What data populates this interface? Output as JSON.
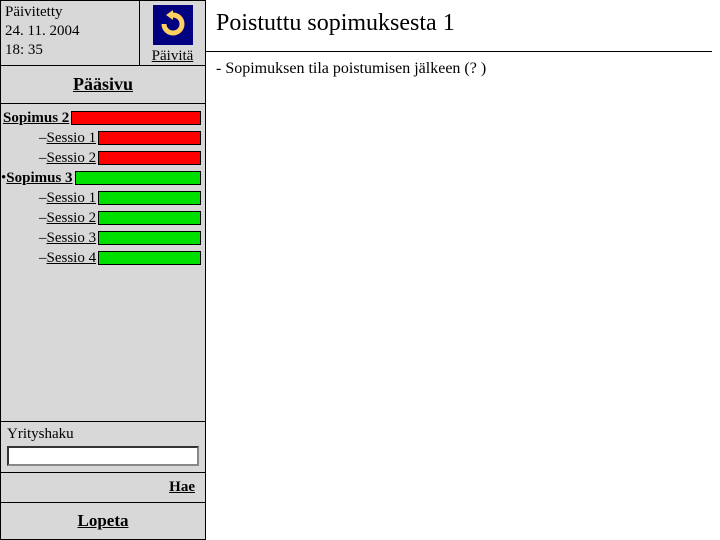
{
  "sidebar": {
    "updated_label": "Päivitetty",
    "updated_date": "24. 11. 2004",
    "updated_time": "18: 35",
    "refresh_label": "Päivitä",
    "main_link": "Pääsivu",
    "tree": [
      {
        "indent": 2,
        "prefix": " ",
        "label": "Sopimus 2",
        "bold": true,
        "status": "red"
      },
      {
        "indent": 38,
        "prefix": "– ",
        "label": "Sessio 1",
        "bold": false,
        "status": "red"
      },
      {
        "indent": 38,
        "prefix": "– ",
        "label": "Sessio 2",
        "bold": false,
        "status": "red"
      },
      {
        "indent": 0,
        "prefix": "• ",
        "label": "Sopimus 3",
        "bold": true,
        "status": "green"
      },
      {
        "indent": 38,
        "prefix": "– ",
        "label": "Sessio 1",
        "bold": false,
        "status": "green"
      },
      {
        "indent": 38,
        "prefix": "– ",
        "label": "Sessio 2",
        "bold": false,
        "status": "green"
      },
      {
        "indent": 38,
        "prefix": "– ",
        "label": "Sessio 3",
        "bold": false,
        "status": "green"
      },
      {
        "indent": 38,
        "prefix": "– ",
        "label": "Sessio 4",
        "bold": false,
        "status": "green"
      }
    ],
    "search_label": "Yrityshaku",
    "search_value": "",
    "search_button": "Hae",
    "quit_label": "Lopeta"
  },
  "main": {
    "title": "Poistuttu sopimuksesta 1",
    "body": "- Sopimuksen tila poistumisen jälkeen  (? )"
  }
}
